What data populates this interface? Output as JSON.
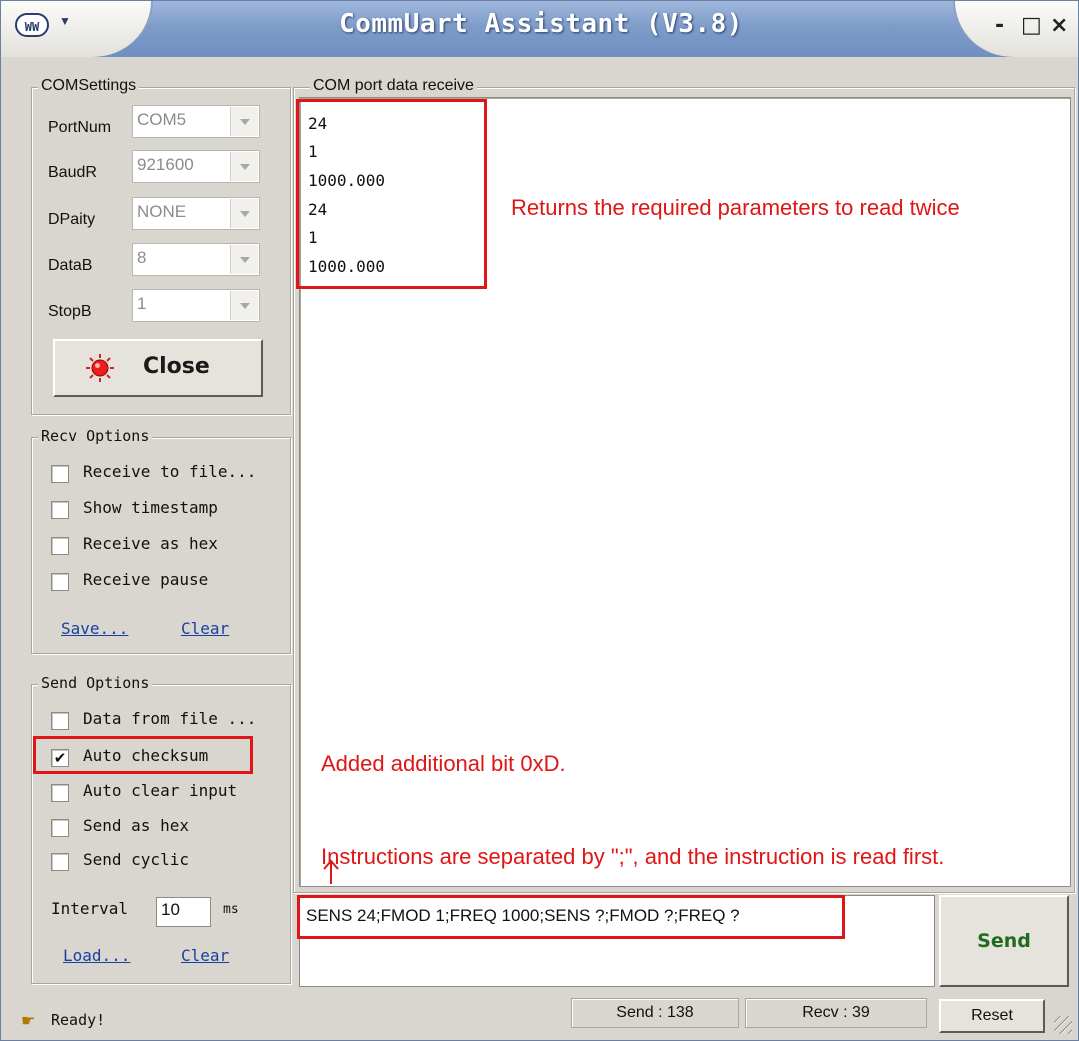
{
  "window": {
    "title": "CommUart Assistant (V3.8)",
    "minimize_glyph": "-",
    "maximize_glyph": "□",
    "close_glyph": "×"
  },
  "com_settings": {
    "title": "COMSettings",
    "fields": [
      {
        "label": "PortNum",
        "value": "COM5"
      },
      {
        "label": "BaudR",
        "value": "921600"
      },
      {
        "label": "DPaity",
        "value": "NONE"
      },
      {
        "label": "DataB",
        "value": "8"
      },
      {
        "label": "StopB",
        "value": "1"
      }
    ],
    "close_button": "Close"
  },
  "recv_options": {
    "title": "Recv Options",
    "items": [
      {
        "label": "Receive to file...",
        "checked": false
      },
      {
        "label": "Show timestamp",
        "checked": false
      },
      {
        "label": "Receive as hex",
        "checked": false
      },
      {
        "label": "Receive pause",
        "checked": false
      }
    ],
    "save_link": "Save...",
    "clear_link": "Clear"
  },
  "send_options": {
    "title": "Send Options",
    "items": [
      {
        "label": "Data from file ...",
        "checked": false
      },
      {
        "label": "Auto checksum",
        "checked": true
      },
      {
        "label": "Auto clear input",
        "checked": false
      },
      {
        "label": "Send as hex",
        "checked": false
      },
      {
        "label": "Send cyclic",
        "checked": false
      }
    ],
    "interval_label": "Interval",
    "interval_value": "10",
    "interval_unit": "ms",
    "load_link": "Load...",
    "clear_link": "Clear"
  },
  "receive_panel": {
    "title": "COM port data receive",
    "lines": [
      "24",
      "1",
      "1000.000",
      "24",
      "1",
      "1000.000"
    ]
  },
  "send_panel": {
    "input_value": "SENS 24;FMOD 1;FREQ 1000;SENS ?;FMOD ?;FREQ ?",
    "send_button": "Send"
  },
  "status_bar": {
    "status": "Ready!",
    "send_count": "Send : 138",
    "recv_count": "Recv : 39",
    "reset_button": "Reset"
  },
  "annotations": {
    "recv_note": "Returns the required parameters to read twice",
    "checksum_note": "Added additional bit 0xD.",
    "instruction_note": "Instructions are separated by \";\", and the instruction is read first."
  },
  "colors": {
    "annotation_red": "#e01515",
    "send_button_text": "#1f6b1f",
    "titlebar_blue": "#7f9cc9"
  }
}
